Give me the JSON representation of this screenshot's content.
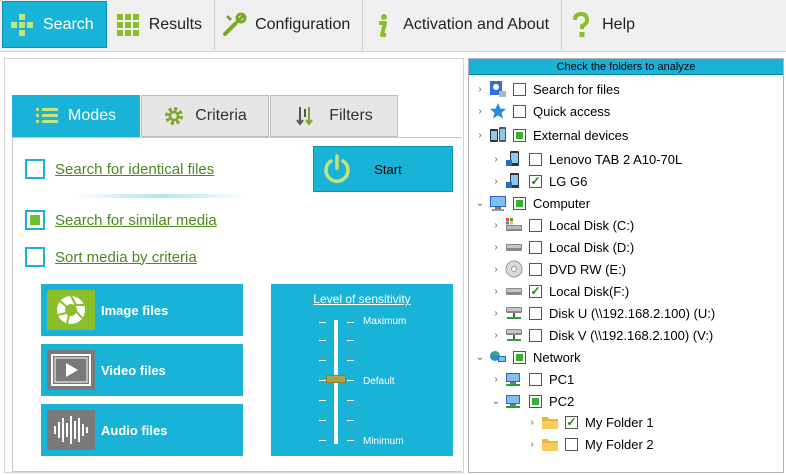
{
  "nav": {
    "search": "Search",
    "results": "Results",
    "configuration": "Configuration",
    "activation": "Activation and About",
    "help": "Help"
  },
  "tabs": {
    "modes": "Modes",
    "criteria": "Criteria",
    "filters": "Filters"
  },
  "options": {
    "identical": "Search for identical files",
    "similar": "Search for similar media",
    "sort": "Sort media by criteria"
  },
  "start_label": "Start",
  "media": {
    "image": "Image files",
    "video": "Video files",
    "audio": "Audio files"
  },
  "sensitivity": {
    "title": "Level of sensitivity",
    "max": "Maximum",
    "default": "Default",
    "min": "Minimum",
    "level": 0.5
  },
  "tree": {
    "header": "Check the folders to analyze",
    "items": [
      {
        "label": "Search for files",
        "state": "none",
        "icon": "search-files-icon"
      },
      {
        "label": "Quick access",
        "state": "none",
        "icon": "star-icon"
      },
      {
        "label": "External devices",
        "state": "partial",
        "icon": "devices-icon"
      },
      {
        "label": "Lenovo TAB 2 A10-70L",
        "state": "none",
        "icon": "phone-icon"
      },
      {
        "label": "LG G6",
        "state": "checked",
        "icon": "phone-icon"
      },
      {
        "label": "Computer",
        "state": "partial",
        "icon": "computer-icon"
      },
      {
        "label": "Local Disk (C:)",
        "state": "none",
        "icon": "windows-drive-icon"
      },
      {
        "label": "Local Disk (D:)",
        "state": "none",
        "icon": "drive-icon"
      },
      {
        "label": "DVD RW (E:)",
        "state": "none",
        "icon": "dvd-icon"
      },
      {
        "label": "Local Disk(F:)",
        "state": "checked",
        "icon": "drive-icon"
      },
      {
        "label": "Disk U  (\\\\192.168.2.100) (U:)",
        "state": "none",
        "icon": "network-drive-icon"
      },
      {
        "label": "Disk V  (\\\\192.168.2.100) (V:)",
        "state": "none",
        "icon": "network-drive-icon"
      },
      {
        "label": "Network",
        "state": "partial",
        "icon": "network-icon"
      },
      {
        "label": "PC1",
        "state": "none",
        "icon": "pc-icon"
      },
      {
        "label": "PC2",
        "state": "partial",
        "icon": "pc-icon"
      },
      {
        "label": "My Folder 1",
        "state": "checked",
        "icon": "folder-icon"
      },
      {
        "label": "My Folder 2",
        "state": "none",
        "icon": "folder-icon"
      }
    ]
  },
  "colors": {
    "accent": "#1ab3d8",
    "green": "#6fbf2f",
    "link_green": "#4c8a1c"
  }
}
